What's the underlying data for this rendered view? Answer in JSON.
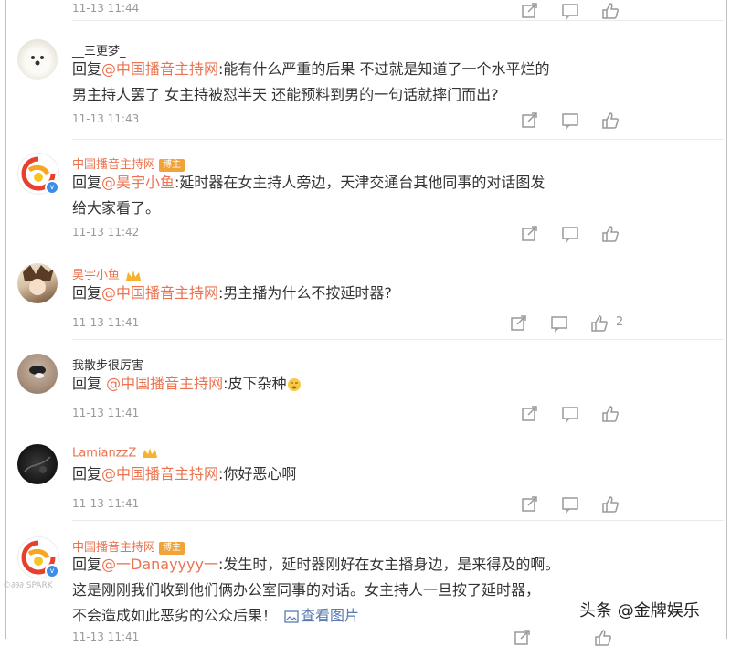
{
  "top_time": "11-13 11:44",
  "comments": [
    {
      "user": "__三更梦_",
      "reply_prefix": "回复",
      "mention": "@中国播音主持网",
      "text_line1": ":能有什么严重的后果 不过就是知道了一个水平烂的",
      "text_line2": "男主持人罢了 女主持被怼半天 还能预料到男的一句话就摔门而出?",
      "time": "11-13 11:43"
    },
    {
      "user": "中国播音主持网",
      "badge": "博主",
      "reply_prefix": "回复",
      "mention": "@昊宇小鱼",
      "text_line1": ":延时器在女主持人旁边，天津交通台其他同事的对话图发",
      "text_line2": "给大家看了。",
      "time": "11-13 11:42"
    },
    {
      "user": "昊宇小鱼",
      "reply_prefix": "回复",
      "mention": "@中国播音主持网",
      "text_line1": ":男主播为什么不按延时器?",
      "time": "11-13 11:41",
      "likes": "2"
    },
    {
      "user": "我散步很厉害",
      "reply_prefix": "回复 ",
      "mention": "@中国播音主持网",
      "text_line1": ":皮下杂种",
      "time": "11-13 11:41"
    },
    {
      "user": "LamianzzZ",
      "reply_prefix": "回复",
      "mention": "@中国播音主持网",
      "text_line1": ":你好恶心啊",
      "time": "11-13 11:41"
    },
    {
      "user": "中国播音主持网",
      "badge": "博主",
      "reply_prefix": "回复",
      "mention": "@一Danayyyy一",
      "text_line1": ":发生时，延时器刚好在女主播身边，是来得及的啊。",
      "text_line2": "这是刚刚我们收到他们俩办公室同事的对话。女主持人一旦按了延时器，",
      "text_line3": "不会造成如此恶劣的公众后果！",
      "view_image": "查看图片",
      "time": "11-13 11:41"
    }
  ],
  "watermark": "头条 @金牌娱乐",
  "side_logo": "©∂∂∂ SPARK"
}
